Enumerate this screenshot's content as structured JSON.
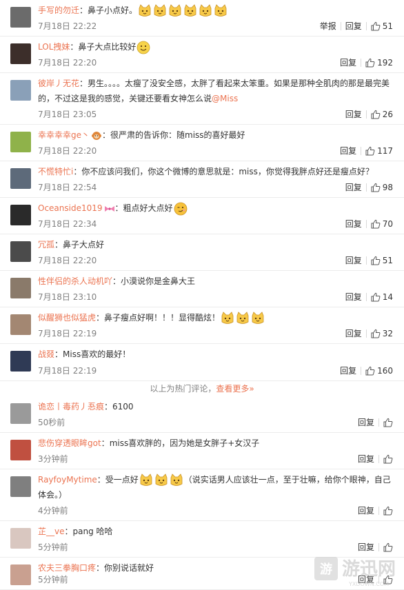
{
  "labels": {
    "reply": "回复",
    "report": "举报"
  },
  "colors": {
    "name": "#eb7350",
    "meta": "#808080"
  },
  "divider": {
    "text": "以上为热门评论，",
    "more": "查看更多»"
  },
  "watermark": {
    "brand": "游迅网",
    "domain": "YXDOWN.COM"
  },
  "comments": [
    {
      "user": "手写的勿迁",
      "sep": "：",
      "text": "鼻子小点好。",
      "emoji": [
        "cat-face",
        "cat-face",
        "cat-face",
        "cat-face",
        "cat-face",
        "cat-face"
      ],
      "time": "7月18日 22:22",
      "report": true,
      "likes": "51"
    },
    {
      "user": "LOL拽妹",
      "sep": "：",
      "text": "鼻子大点比较好",
      "emoji": [
        "smile-face"
      ],
      "time": "7月18日 22:20",
      "likes": "192"
    },
    {
      "user": "彼岸丿无花",
      "sep": "：",
      "text": "男生。。。。太瘦了没安全感，太胖了看起来太笨重。如果是那种全肌肉的那是最完美的，不过这是我的感觉，关键还要看女神怎么说",
      "mention": "@Miss",
      "time": "7月18日 23:05",
      "likes": "26"
    },
    {
      "user": "幸幸幸幸ge丶",
      "badge": "monkey-icon",
      "sep": "：",
      "text": "很严肃的告诉你：随miss的喜好最好",
      "time": "7月18日 22:20",
      "likes": "117"
    },
    {
      "user": "不慌特忙i",
      "sep": "：",
      "text": "你不应该问我们，你这个微博的意思就是：miss，你觉得我胖点好还是瘦点好？",
      "time": "7月18日 22:54",
      "likes": "98"
    },
    {
      "user": "Oceanside1019",
      "badge": "bow-icon",
      "sep": "：",
      "text": "粗点好大点好",
      "emoji": [
        "wink-face"
      ],
      "time": "7月18日 22:34",
      "likes": "70"
    },
    {
      "user": "冗孤",
      "sep": "：",
      "text": "鼻子大点好",
      "time": "7月18日 22:20",
      "likes": "51"
    },
    {
      "user": "性伴侣的杀人动机吖",
      "sep": "：",
      "text": "小漠说你是金鼻大王",
      "time": "7月18日 23:10",
      "likes": "14"
    },
    {
      "user": "似醒狮也似猛虎",
      "sep": "：",
      "text": "鼻子瘦点好啊！！！显得酷炫！",
      "emoji": [
        "cat-face",
        "cat-face",
        "cat-face"
      ],
      "time": "7月18日 22:19",
      "likes": "32"
    },
    {
      "user": "战叕",
      "sep": "：",
      "text": "Miss喜欢的最好！",
      "time": "7月18日 22:19",
      "likes": "160"
    },
    {
      "user": "诡恋丨毒药丿忢痕",
      "sep": "：",
      "text": "6100",
      "time": "50秒前",
      "likes": ""
    },
    {
      "user": "悲伤穿透眼眸got",
      "sep": "：",
      "text": "miss喜欢胖的，因为她是女胖子+女汉子",
      "time": "3分钟前",
      "likes": ""
    },
    {
      "user": "RayfoyMytime",
      "sep": "：",
      "text": "受一点好",
      "emoji": [
        "cat-face",
        "cat-face",
        "cat-face"
      ],
      "text2": "（说实话男人应该壮一点，至于壮嘛，给你个眼神，自己体会。）",
      "time": "4分钟前",
      "likes": ""
    },
    {
      "user": "芷__ve",
      "sep": "：",
      "text": "pang 哈哈",
      "time": "5分钟前",
      "likes": ""
    },
    {
      "user": "农夫三拳胸口疼",
      "sep": "：",
      "text": "你别说话就好",
      "time": "5分钟前",
      "likes": ""
    }
  ]
}
